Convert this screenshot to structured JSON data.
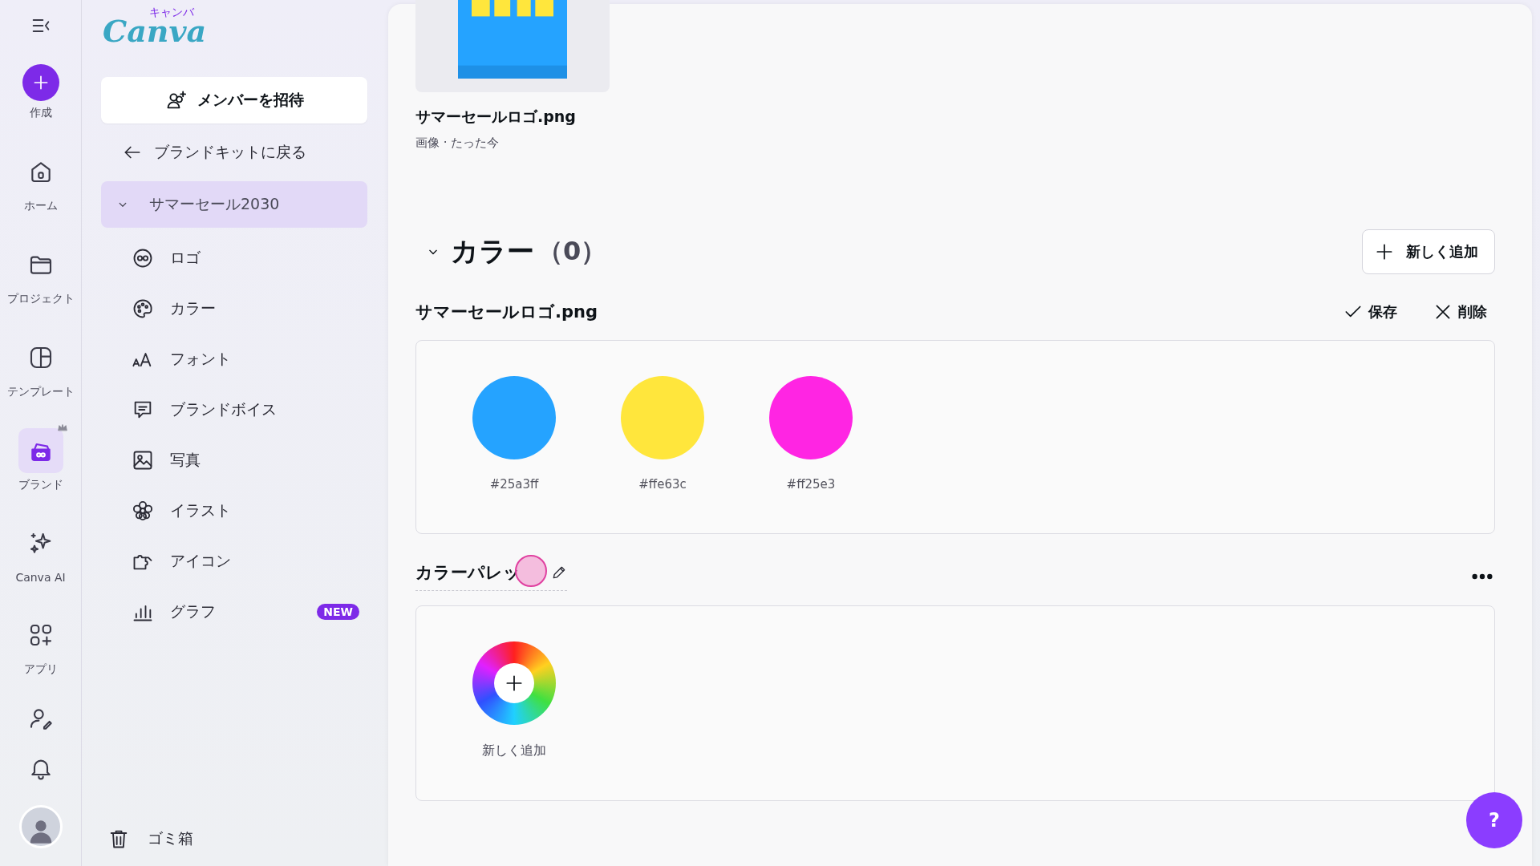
{
  "rail": {
    "items": [
      {
        "kind": "create",
        "label": "作成",
        "selected": false
      },
      {
        "kind": "nav",
        "label": "ホーム",
        "selected": false
      },
      {
        "kind": "nav",
        "label": "プロジェクト",
        "selected": false
      },
      {
        "kind": "nav",
        "label": "テンプレート",
        "selected": false
      },
      {
        "kind": "nav",
        "label": "ブランド",
        "selected": true
      },
      {
        "kind": "nav",
        "label": "Canva AI",
        "selected": false
      },
      {
        "kind": "nav",
        "label": "アプリ",
        "selected": false
      }
    ]
  },
  "sidebar": {
    "logo": {
      "text": "Canva",
      "kana": "キャンバ"
    },
    "invite_button": "メンバーを招待",
    "back_link": "ブランドキットに戻る",
    "kit": {
      "name": "サマーセール2030",
      "expanded": true,
      "selected": true
    },
    "items": [
      {
        "label": "ロゴ"
      },
      {
        "label": "カラー"
      },
      {
        "label": "フォント"
      },
      {
        "label": "ブランドボイス"
      },
      {
        "label": "写真"
      },
      {
        "label": "イラスト"
      },
      {
        "label": "アイコン"
      },
      {
        "label": "グラフ",
        "badge": "NEW"
      }
    ],
    "trash": "ゴミ箱"
  },
  "main": {
    "asset": {
      "name": "サマーセールロゴ.png",
      "meta": "画像 · たった今"
    },
    "colors": {
      "title": "カラー",
      "count": "（0）",
      "expanded": true,
      "add_button": "新しく追加",
      "group": {
        "name": "サマーセールロゴ.png",
        "save": "保存",
        "delete": "削除",
        "swatches": [
          {
            "color": "#25a3ff",
            "label": "#25a3ff"
          },
          {
            "color": "#ffe63c",
            "label": "#ffe63c"
          },
          {
            "color": "#ff25e3",
            "label": "#ff25e3"
          }
        ]
      },
      "palette": {
        "title": "カラーパレッ",
        "add_label": "新しく追加"
      }
    },
    "help_button": "?"
  }
}
